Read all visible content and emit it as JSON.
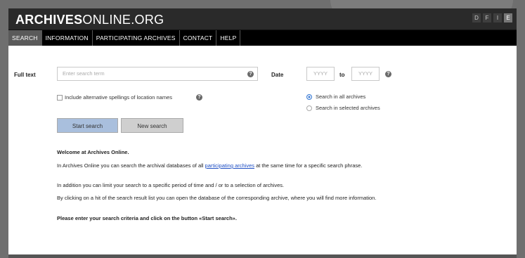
{
  "app": {
    "logo_bold": "ARCHIVES",
    "logo_light": "ONLINE.ORG",
    "languages": [
      "D",
      "F",
      "I",
      "E"
    ]
  },
  "nav": {
    "items": [
      "SEARCH",
      "INFORMATION",
      "PARTICIPATING ARCHIVES",
      "CONTACT",
      "HELP"
    ],
    "active": "SEARCH"
  },
  "search": {
    "full_text_label": "Full text",
    "full_text_placeholder": "Enter search term",
    "date_label": "Date",
    "date_from_placeholder": "YYYY",
    "date_to_label": "to",
    "date_to_placeholder": "YYYY",
    "alt_spellings_label": "Include alternative spellings of location names",
    "radio_all": "Search in all archives",
    "radio_selected": "Search in selected archives",
    "start_button": "Start search",
    "new_button": "New search"
  },
  "welcome": {
    "heading": "Welcome at Archives Online.",
    "p1_before": "In Archives Online you can search the archival databases of all ",
    "p1_link": "participating archives",
    "p1_after": " at the same time for a specific search phrase.",
    "p2": "In addition you can limit your search to a specific period of time and / or to a selection of archives.",
    "p3": "By clicking on a hit of the search result list you can open the database of the corresponding archive, where you will find more information.",
    "p4": "Please enter your search criteria and click on the button «Start search»."
  },
  "colors": {
    "header_bg": "#2a2a2a",
    "nav_bg": "#000000",
    "primary_button": "#a9bfdd",
    "link": "#1f4fc4"
  }
}
